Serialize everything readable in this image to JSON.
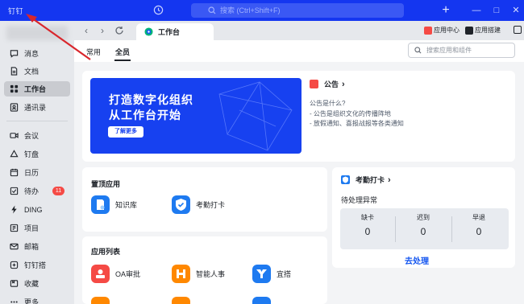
{
  "titlebar": {
    "app_logo": "钉钉",
    "search_placeholder": "搜索 (Ctrl+Shift+F)",
    "new_button": "+",
    "colors": {
      "background": "#1436f0",
      "search_bg": "#3a58f4"
    }
  },
  "sidebar": {
    "items": [
      {
        "label": "消息",
        "icon": "message-icon",
        "active": false
      },
      {
        "label": "文档",
        "icon": "document-icon",
        "active": false
      },
      {
        "label": "工作台",
        "icon": "grid-icon",
        "active": true
      },
      {
        "label": "通讯录",
        "icon": "contacts-icon",
        "active": false
      },
      {
        "label": "会议",
        "icon": "meeting-icon",
        "active": false
      },
      {
        "label": "钉盘",
        "icon": "cloud-drive-icon",
        "active": false
      },
      {
        "label": "日历",
        "icon": "calendar-icon",
        "active": false
      },
      {
        "label": "待办",
        "icon": "todo-icon",
        "active": false,
        "badge": "11"
      },
      {
        "label": "DING",
        "icon": "lightning-icon",
        "active": false
      },
      {
        "label": "项目",
        "icon": "project-icon",
        "active": false
      },
      {
        "label": "邮箱",
        "icon": "mail-icon",
        "active": false
      },
      {
        "label": "钉钉搭",
        "icon": "builder-icon",
        "active": false
      },
      {
        "label": "收藏",
        "icon": "favorites-icon",
        "active": false
      },
      {
        "label": "更多",
        "icon": "more-icon",
        "active": false
      }
    ]
  },
  "tabbar": {
    "active_tab": "工作台",
    "links": [
      {
        "label": "应用中心",
        "icon": "app-center-icon"
      },
      {
        "label": "应用搭建",
        "icon": "app-builder-icon"
      }
    ]
  },
  "workbench": {
    "subtabs": [
      "常用",
      "全员"
    ],
    "active_subtab": "全员",
    "search_placeholder": "搜索应用和组件",
    "banner": {
      "title_line1": "打造数字化组织",
      "title_line2": "从工作台开始",
      "button": "了解更多",
      "color": "#1741f0"
    },
    "notice": {
      "title": "公告",
      "lines": [
        "公告是什么?",
        "- 公告是组织文化的传播阵地",
        "- 放假通知、喜报战报等各类通知"
      ]
    },
    "pinned": {
      "title": "置顶应用",
      "apps": [
        {
          "label": "知识库",
          "icon": "knowledge-base-icon"
        },
        {
          "label": "考勤打卡",
          "icon": "attendance-icon"
        }
      ]
    },
    "app_list": {
      "title": "应用列表",
      "apps": [
        {
          "label": "OA审批",
          "icon": "oa-approval-icon"
        },
        {
          "label": "智能人事",
          "icon": "smart-hr-icon"
        },
        {
          "label": "宜搭",
          "icon": "yida-icon"
        }
      ]
    },
    "attendance": {
      "title": "考勤打卡",
      "pending_label": "待处理异常",
      "stats": [
        {
          "label": "缺卡",
          "value": "0"
        },
        {
          "label": "迟到",
          "value": "0"
        },
        {
          "label": "早退",
          "value": "0"
        }
      ],
      "action": "去处理"
    }
  }
}
